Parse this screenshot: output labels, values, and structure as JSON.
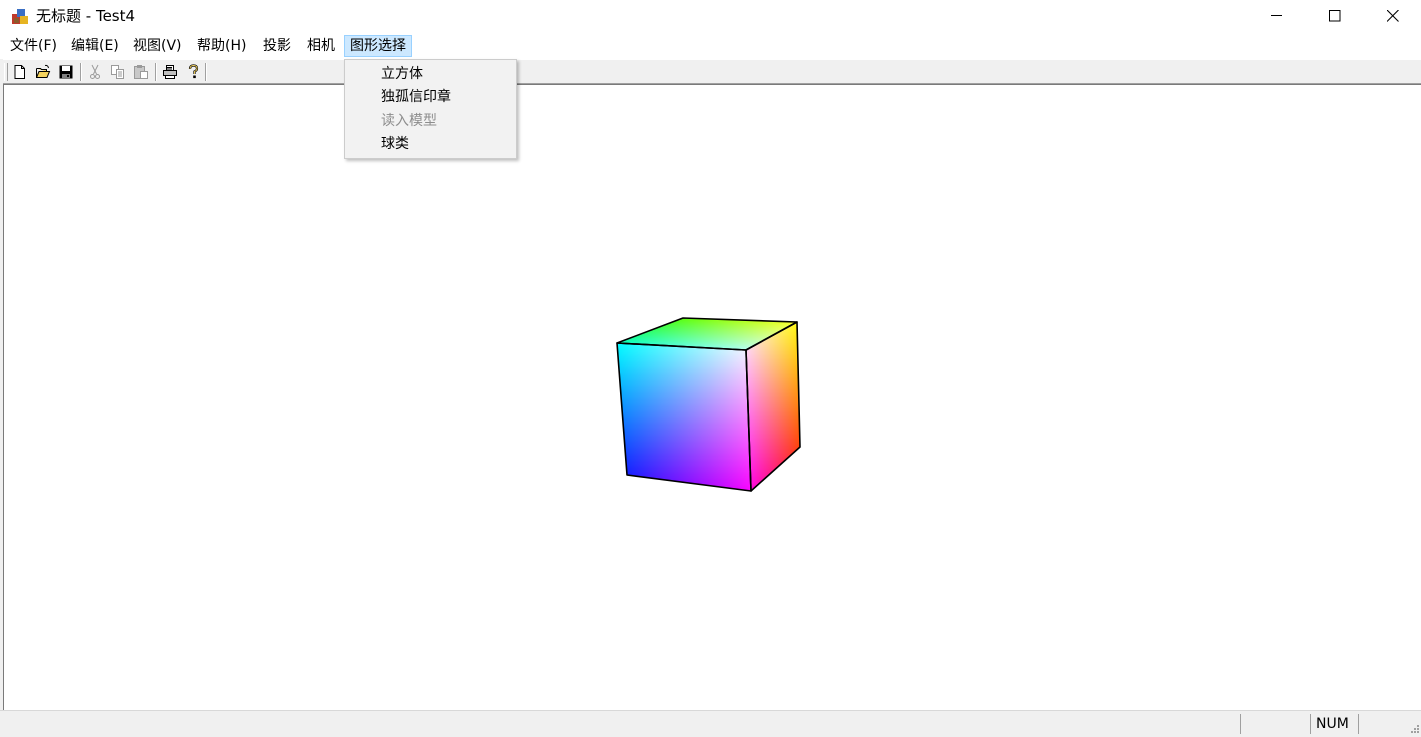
{
  "window": {
    "title": "无标题 - Test4"
  },
  "menubar": {
    "items": [
      {
        "label": "文件(F)"
      },
      {
        "label": "编辑(E)"
      },
      {
        "label": "视图(V)"
      },
      {
        "label": "帮助(H)"
      },
      {
        "label": "投影"
      },
      {
        "label": "相机"
      },
      {
        "label": "图形选择",
        "active": true
      }
    ]
  },
  "dropdown": {
    "items": [
      {
        "label": "立方体",
        "enabled": true
      },
      {
        "label": "独孤信印章",
        "enabled": true
      },
      {
        "label": "读入模型",
        "enabled": false
      },
      {
        "label": "球类",
        "enabled": true
      }
    ]
  },
  "toolbar": {
    "buttons": [
      "new-file-icon",
      "open-folder-icon",
      "save-icon",
      "cut-icon",
      "copy-icon",
      "paste-icon",
      "print-icon",
      "help-icon"
    ]
  },
  "statusbar": {
    "num_indicator": "NUM"
  },
  "colors": {
    "menu_highlight": "#cce8ff",
    "menu_highlight_border": "#99d1ff",
    "dropdown_bg": "#f2f2f2",
    "disabled_text": "#8d8d8d"
  }
}
